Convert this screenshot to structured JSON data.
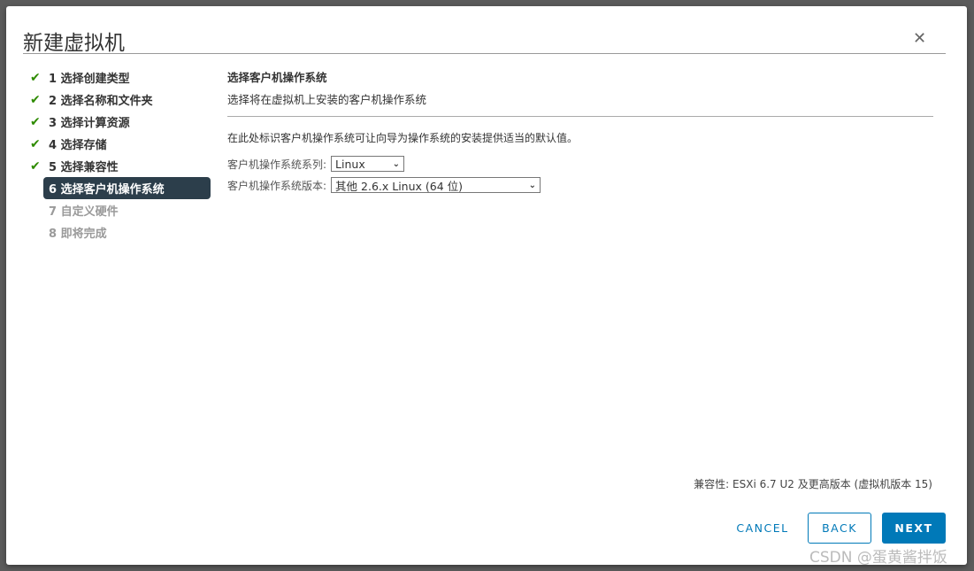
{
  "dialog": {
    "title": "新建虚拟机",
    "close_icon": "close-icon"
  },
  "steps": [
    {
      "label": "1 选择创建类型",
      "status": "done"
    },
    {
      "label": "2 选择名称和文件夹",
      "status": "done"
    },
    {
      "label": "3 选择计算资源",
      "status": "done"
    },
    {
      "label": "4 选择存储",
      "status": "done"
    },
    {
      "label": "5 选择兼容性",
      "status": "done"
    },
    {
      "label": "6 选择客户机操作系统",
      "status": "active"
    },
    {
      "label": "7 自定义硬件",
      "status": "future"
    },
    {
      "label": "8 即将完成",
      "status": "future"
    }
  ],
  "content": {
    "heading": "选择客户机操作系统",
    "subheading": "选择将在虚拟机上安装的客户机操作系统",
    "description": "在此处标识客户机操作系统可让向导为操作系统的安装提供适当的默认值。",
    "family_label": "客户机操作系统系列:",
    "family_value": "Linux",
    "version_label": "客户机操作系统版本:",
    "version_value": "其他 2.6.x Linux (64 位)"
  },
  "compatibility": "兼容性: ESXi 6.7 U2 及更高版本 (虚拟机版本 15)",
  "buttons": {
    "cancel": "CANCEL",
    "back": "BACK",
    "next": "NEXT"
  },
  "watermark": "CSDN @蛋黄酱拌饭",
  "colors": {
    "accent": "#0079b8",
    "active_step": "#2c3e4b",
    "check": "#2e8b00"
  }
}
